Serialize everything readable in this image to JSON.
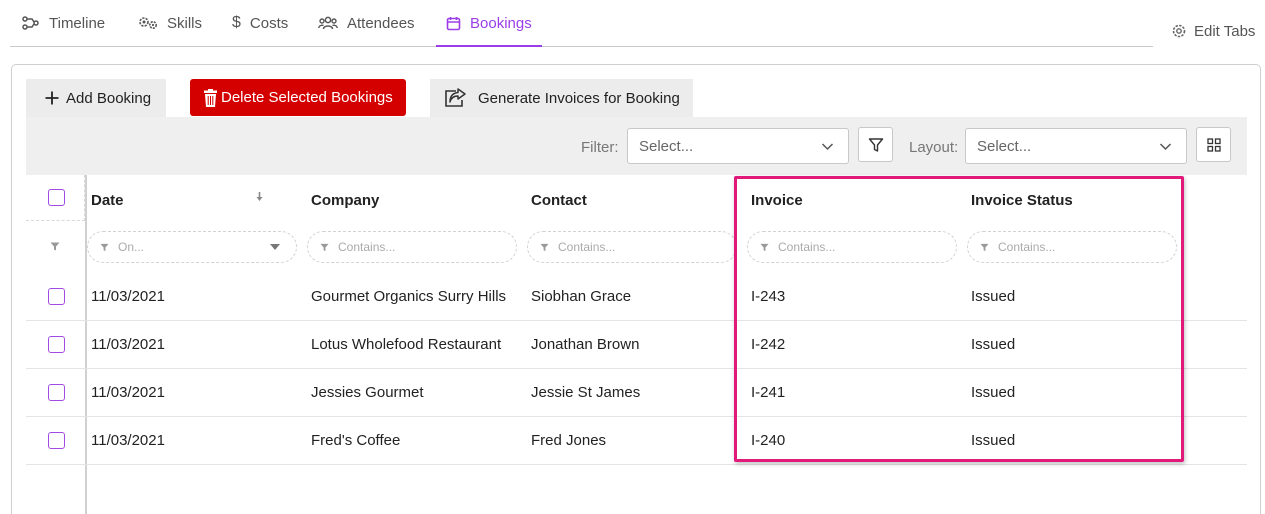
{
  "tabs": [
    {
      "label": "Timeline",
      "icon": "timeline-icon",
      "active": false
    },
    {
      "label": "Skills",
      "icon": "gears-icon",
      "active": false
    },
    {
      "label": "Costs",
      "icon": "dollar-icon",
      "active": false
    },
    {
      "label": "Attendees",
      "icon": "people-icon",
      "active": false
    },
    {
      "label": "Bookings",
      "icon": "calendar-icon",
      "active": true
    }
  ],
  "edit_tabs_label": "Edit Tabs",
  "actions": {
    "add_booking": "Add Booking",
    "delete_selected": "Delete Selected Bookings",
    "generate_invoices": "Generate Invoices for Booking"
  },
  "toolbar": {
    "filter_label": "Filter:",
    "filter_placeholder": "Select...",
    "layout_label": "Layout:",
    "layout_placeholder": "Select..."
  },
  "grid": {
    "columns": [
      "Date",
      "Company",
      "Contact",
      "Invoice",
      "Invoice Status"
    ],
    "filters": [
      "On...",
      "Contains...",
      "Contains...",
      "Contains...",
      "Contains..."
    ],
    "rows": [
      {
        "date": "11/03/2021",
        "company": "Gourmet Organics Surry Hills",
        "contact": "Siobhan Grace",
        "invoice": "I-243",
        "status": "Issued"
      },
      {
        "date": "11/03/2021",
        "company": "Lotus Wholefood Restaurant",
        "contact": "Jonathan Brown",
        "invoice": "I-242",
        "status": "Issued"
      },
      {
        "date": "11/03/2021",
        "company": "Jessies Gourmet",
        "contact": "Jessie St James",
        "invoice": "I-241",
        "status": "Issued"
      },
      {
        "date": "11/03/2021",
        "company": "Fred's Coffee",
        "contact": "Fred Jones",
        "invoice": "I-240",
        "status": "Issued"
      }
    ]
  },
  "colors": {
    "accent": "#9b3ee8",
    "danger": "#d40000",
    "highlight": "#e0197a"
  }
}
